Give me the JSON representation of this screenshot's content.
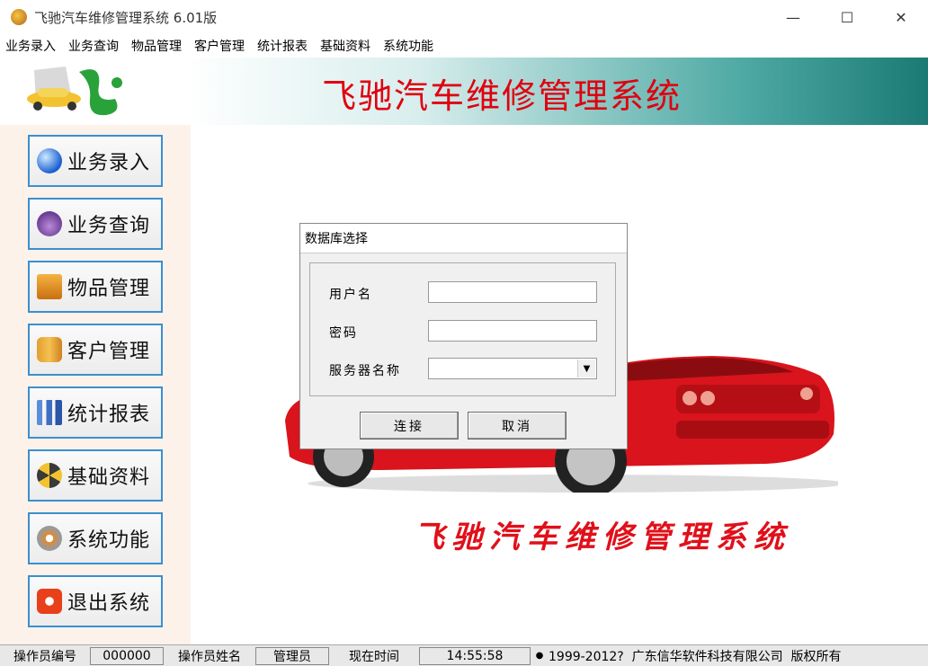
{
  "window": {
    "title": "飞驰汽车维修管理系统 6.01版",
    "minimize": "—",
    "maximize": "☐",
    "close": "✕"
  },
  "menu": [
    "业务录入",
    "业务查询",
    "物品管理",
    "客户管理",
    "统计报表",
    "基础资料",
    "系统功能"
  ],
  "banner": {
    "title": "飞驰汽车维修管理系统"
  },
  "sidebar": [
    {
      "label": "业务录入",
      "icon": "globe-icon"
    },
    {
      "label": "业务查询",
      "icon": "magnifier-icon"
    },
    {
      "label": "物品管理",
      "icon": "box-icon"
    },
    {
      "label": "客户管理",
      "icon": "people-icon"
    },
    {
      "label": "统计报表",
      "icon": "bar-chart-icon"
    },
    {
      "label": "基础资料",
      "icon": "radiation-icon"
    },
    {
      "label": "系统功能",
      "icon": "gear-icon"
    },
    {
      "label": "退出系统",
      "icon": "power-icon"
    }
  ],
  "splash": {
    "slogan": "飞驰汽车维修管理系统"
  },
  "dialog": {
    "title": "数据库选择",
    "username_label": "用户名",
    "username_value": "",
    "password_label": "密码",
    "password_value": "",
    "server_label": "服务器名称",
    "server_value": "",
    "connect": "连接",
    "cancel": "取消"
  },
  "status": {
    "operator_id_label": "操作员编号",
    "operator_id": "000000",
    "operator_name_label": "操作员姓名",
    "operator_name": "管理员",
    "time_label": "现在时间",
    "time": "14:55:58",
    "copyright": "1999-2012?  广东信华软件科技有限公司  版权所有"
  },
  "colors": {
    "banner_title": "#e00010",
    "sidebar_bg": "#fdf2ea",
    "nav_border": "#3b8fcf",
    "car_red": "#d9141c"
  }
}
